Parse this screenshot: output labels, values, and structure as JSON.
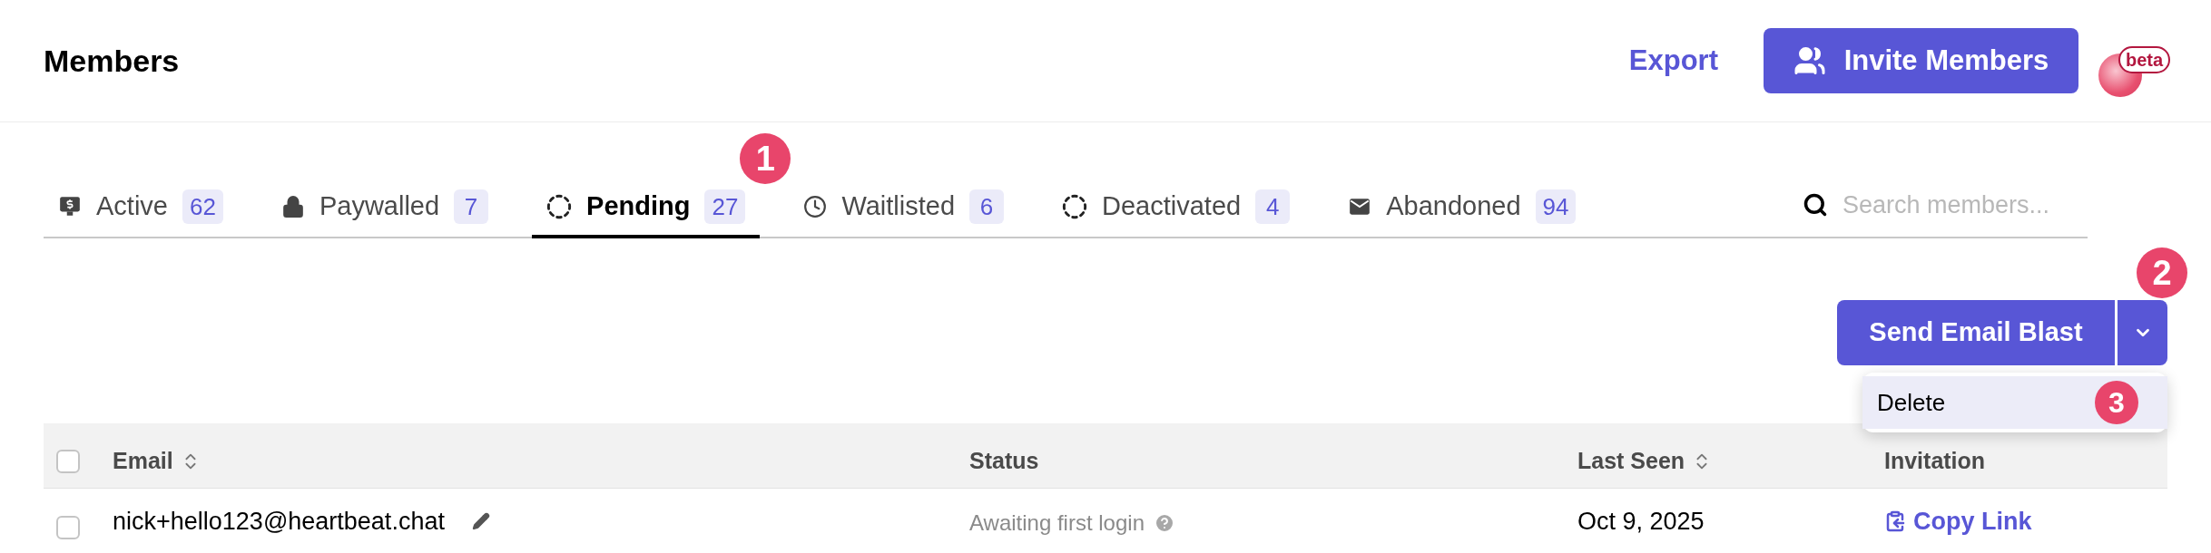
{
  "header": {
    "title": "Members",
    "export_link": "Export",
    "invite_button": "Invite Members",
    "beta_badge": "beta"
  },
  "tabs": [
    {
      "kind": "active",
      "label": "Active",
      "count": "62",
      "selected": false
    },
    {
      "kind": "lock",
      "label": "Paywalled",
      "count": "7",
      "selected": false
    },
    {
      "kind": "pending",
      "label": "Pending",
      "count": "27",
      "selected": true,
      "annotation": "1"
    },
    {
      "kind": "clock",
      "label": "Waitlisted",
      "count": "6",
      "selected": false
    },
    {
      "kind": "pending",
      "label": "Deactivated",
      "count": "4",
      "selected": false
    },
    {
      "kind": "mail",
      "label": "Abandoned",
      "count": "94",
      "selected": false
    }
  ],
  "search": {
    "placeholder": "Search members..."
  },
  "email_blast": {
    "label": "Send Email Blast",
    "annotation": "2",
    "menu": [
      {
        "label": "Delete",
        "selected": true,
        "annotation": "3"
      }
    ]
  },
  "table": {
    "select_all_checked": false,
    "columns": [
      {
        "label": "Email",
        "sortable": true
      },
      {
        "label": "Status",
        "sortable": false
      },
      {
        "label": "Last Seen",
        "sortable": true
      },
      {
        "label": "Invitation",
        "sortable": false
      }
    ],
    "rows": [
      {
        "checked": false,
        "email": "nick+hello123@heartbeat.chat",
        "status": "Awaiting first login",
        "last_seen": "Oct 9, 2025",
        "invitation": "Copy Link"
      }
    ]
  }
}
